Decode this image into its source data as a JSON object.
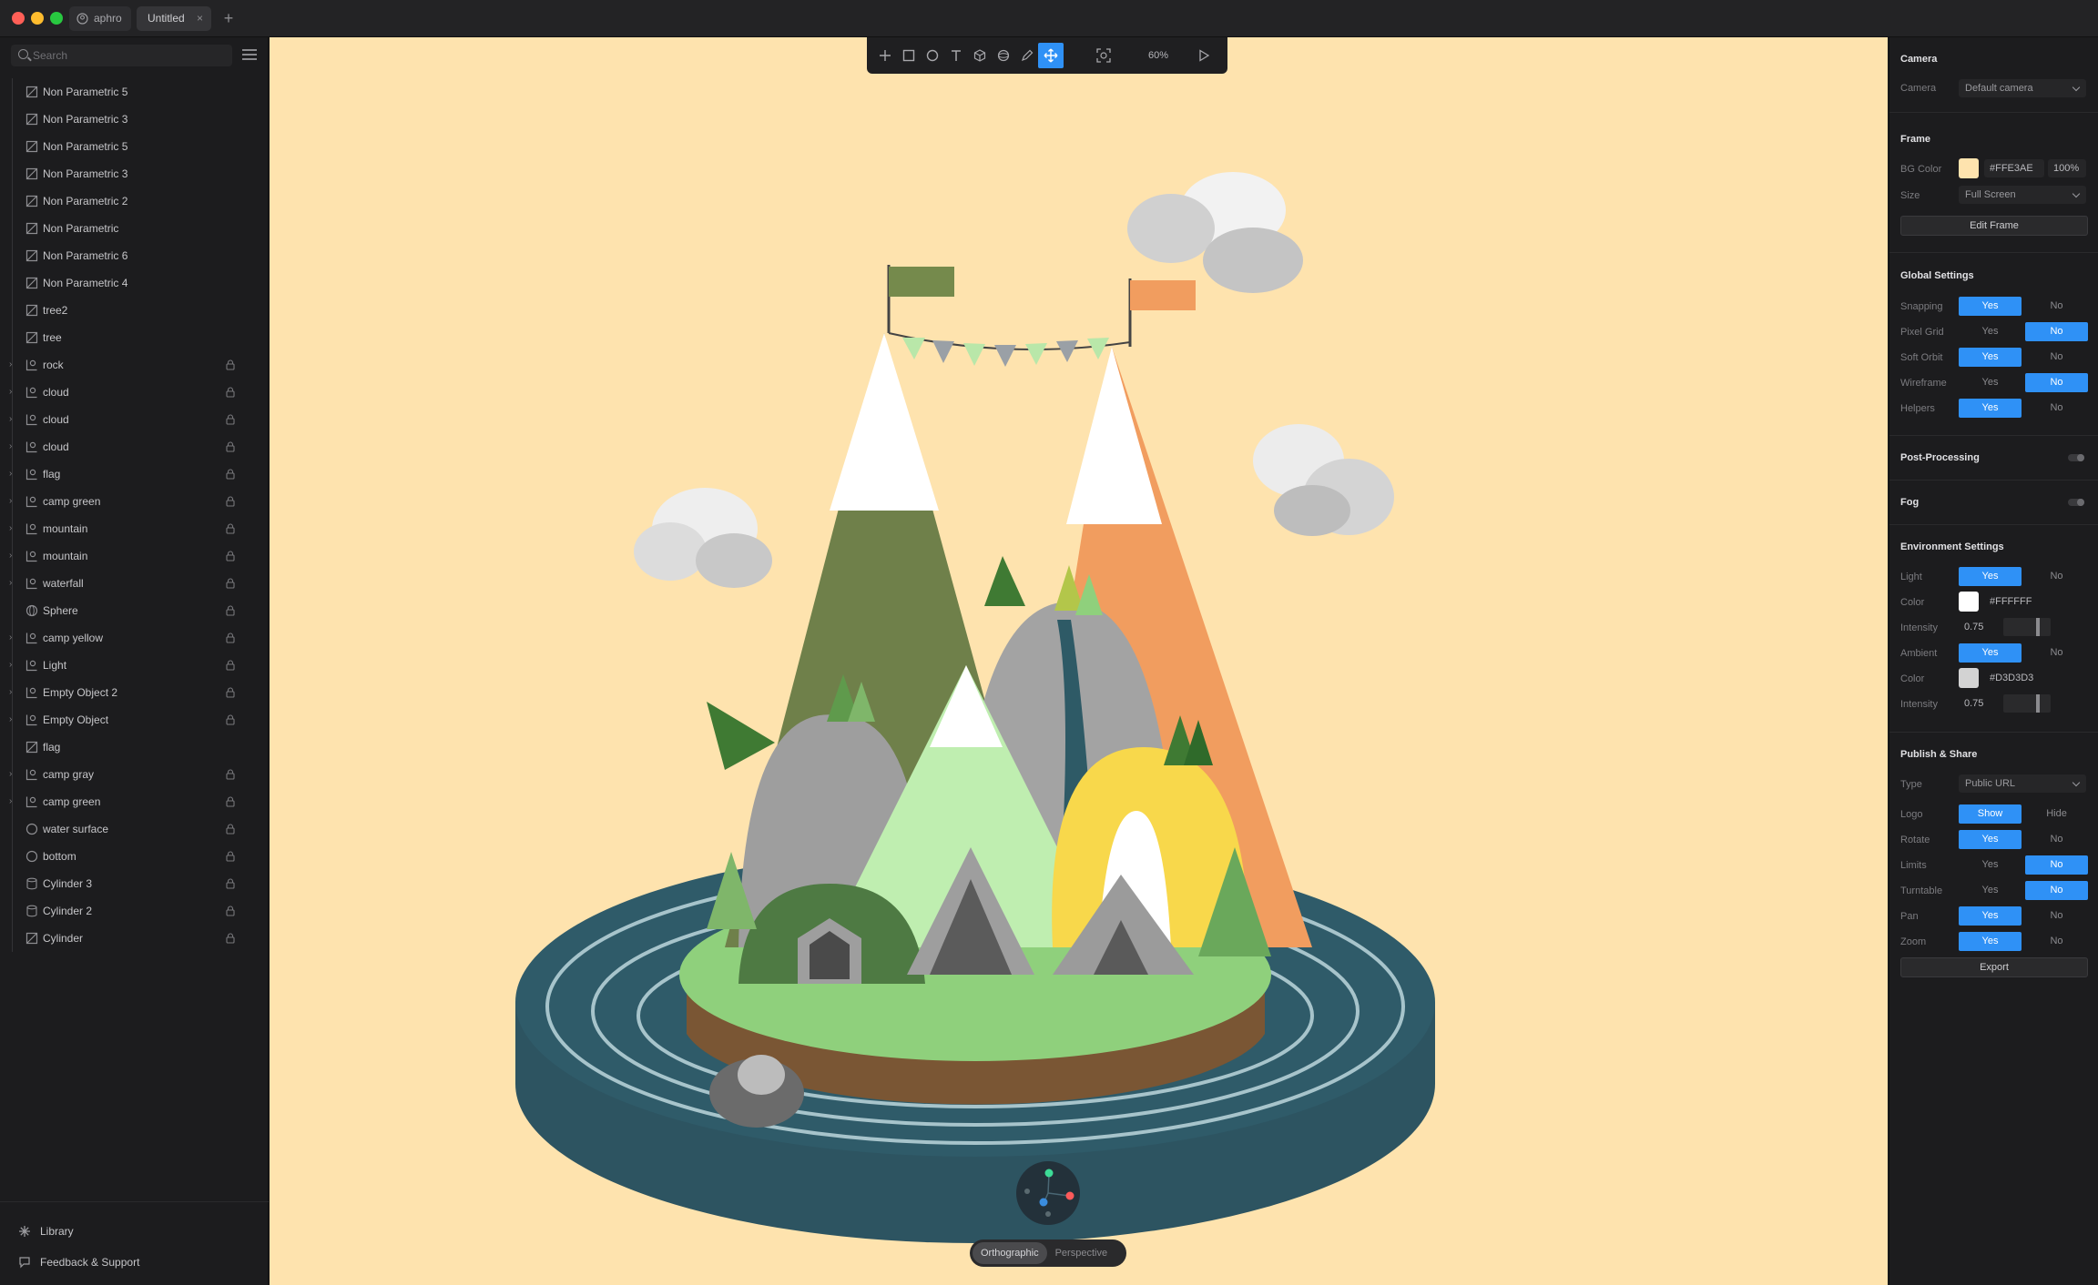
{
  "tabs": {
    "home_label": "aphro",
    "doc_label": "Untitled",
    "close_glyph": "×",
    "add_glyph": "+"
  },
  "sidebar": {
    "search_placeholder": "Search",
    "layers": [
      {
        "name": "Non Parametric 5",
        "icon": "mesh-icon",
        "expandable": false,
        "locked": false
      },
      {
        "name": "Non Parametric 3",
        "icon": "mesh-icon",
        "expandable": false,
        "locked": false
      },
      {
        "name": "Non Parametric 5",
        "icon": "mesh-icon",
        "expandable": false,
        "locked": false
      },
      {
        "name": "Non Parametric 3",
        "icon": "mesh-icon",
        "expandable": false,
        "locked": false
      },
      {
        "name": "Non Parametric 2",
        "icon": "mesh-icon",
        "expandable": false,
        "locked": false
      },
      {
        "name": "Non Parametric",
        "icon": "mesh-icon",
        "expandable": false,
        "locked": false
      },
      {
        "name": "Non Parametric 6",
        "icon": "mesh-icon",
        "expandable": false,
        "locked": false
      },
      {
        "name": "Non Parametric 4",
        "icon": "mesh-icon",
        "expandable": false,
        "locked": false
      },
      {
        "name": "tree2",
        "icon": "mesh-icon",
        "expandable": false,
        "locked": false
      },
      {
        "name": "tree",
        "icon": "mesh-icon",
        "expandable": false,
        "locked": false
      },
      {
        "name": "rock",
        "icon": "group-icon",
        "expandable": true,
        "locked": true
      },
      {
        "name": "cloud",
        "icon": "group-icon",
        "expandable": true,
        "locked": true
      },
      {
        "name": "cloud",
        "icon": "group-icon",
        "expandable": true,
        "locked": true
      },
      {
        "name": "cloud",
        "icon": "group-icon",
        "expandable": true,
        "locked": true
      },
      {
        "name": "flag",
        "icon": "group-icon",
        "expandable": true,
        "locked": true
      },
      {
        "name": "camp green",
        "icon": "group-icon",
        "expandable": true,
        "locked": true
      },
      {
        "name": "mountain",
        "icon": "group-icon",
        "expandable": true,
        "locked": true
      },
      {
        "name": "mountain",
        "icon": "group-icon",
        "expandable": true,
        "locked": true
      },
      {
        "name": "waterfall",
        "icon": "group-icon",
        "expandable": true,
        "locked": true
      },
      {
        "name": "Sphere",
        "icon": "sphere-icon",
        "expandable": false,
        "locked": true
      },
      {
        "name": "camp yellow",
        "icon": "group-icon",
        "expandable": true,
        "locked": true
      },
      {
        "name": "Light",
        "icon": "group-icon",
        "expandable": true,
        "locked": true
      },
      {
        "name": "Empty Object 2",
        "icon": "group-icon",
        "expandable": true,
        "locked": true
      },
      {
        "name": "Empty Object",
        "icon": "group-icon",
        "expandable": true,
        "locked": true
      },
      {
        "name": "flag",
        "icon": "mesh-icon",
        "expandable": false,
        "locked": false
      },
      {
        "name": "camp gray",
        "icon": "group-icon",
        "expandable": true,
        "locked": true
      },
      {
        "name": "camp green",
        "icon": "group-icon",
        "expandable": true,
        "locked": true
      },
      {
        "name": "water surface",
        "icon": "circle-icon",
        "expandable": false,
        "locked": true
      },
      {
        "name": "bottom",
        "icon": "circle-icon",
        "expandable": false,
        "locked": true
      },
      {
        "name": "Cylinder 3",
        "icon": "cylinder-icon",
        "expandable": false,
        "locked": true
      },
      {
        "name": "Cylinder 2",
        "icon": "cylinder-icon",
        "expandable": false,
        "locked": true
      },
      {
        "name": "Cylinder",
        "icon": "mesh-icon",
        "expandable": false,
        "locked": true
      }
    ],
    "library_label": "Library",
    "feedback_label": "Feedback & Support"
  },
  "toolbar": {
    "zoom": "60%",
    "active_tool": "move-icon"
  },
  "viewport": {
    "projection_options": [
      "Orthographic",
      "Perspective"
    ],
    "projection_active": "Orthographic"
  },
  "panel": {
    "camera": {
      "title": "Camera",
      "label": "Camera",
      "value": "Default camera"
    },
    "frame": {
      "title": "Frame",
      "bg_label": "BG Color",
      "bg_color": "#FEE3AE",
      "bg_hex": "#FFE3AE",
      "bg_opacity": "100%",
      "size_label": "Size",
      "size_value": "Full Screen",
      "edit_label": "Edit Frame"
    },
    "global": {
      "title": "Global Settings",
      "rows": [
        {
          "label": "Snapping",
          "yes": "Yes",
          "no": "No",
          "value": "yes"
        },
        {
          "label": "Pixel Grid",
          "yes": "Yes",
          "no": "No",
          "value": "no"
        },
        {
          "label": "Soft Orbit",
          "yes": "Yes",
          "no": "No",
          "value": "yes"
        },
        {
          "label": "Wireframe",
          "yes": "Yes",
          "no": "No",
          "value": "no"
        },
        {
          "label": "Helpers",
          "yes": "Yes",
          "no": "No",
          "value": "yes"
        }
      ]
    },
    "post_processing": {
      "title": "Post-Processing",
      "enabled": false
    },
    "fog": {
      "title": "Fog",
      "enabled": false
    },
    "environment": {
      "title": "Environment Settings",
      "light_label": "Light",
      "light_yes": "Yes",
      "light_no": "No",
      "light_value": "yes",
      "color_label": "Color",
      "light_color": "#FFFFFF",
      "light_hex": "#FFFFFF",
      "intensity_label": "Intensity",
      "light_intensity": "0.75",
      "light_intensity_level": 0.75,
      "ambient_label": "Ambient",
      "ambient_yes": "Yes",
      "ambient_no": "No",
      "ambient_value": "yes",
      "ambient_color_label": "Color",
      "ambient_color": "#D3D3D3",
      "ambient_hex": "#D3D3D3",
      "ambient_intensity_label": "Intensity",
      "ambient_intensity": "0.75",
      "ambient_intensity_level": 0.75
    },
    "publish": {
      "title": "Publish & Share",
      "type_label": "Type",
      "type_value": "Public URL",
      "rows": [
        {
          "label": "Logo",
          "yes": "Show",
          "no": "Hide",
          "value": "yes"
        },
        {
          "label": "Rotate",
          "yes": "Yes",
          "no": "No",
          "value": "yes"
        },
        {
          "label": "Limits",
          "yes": "Yes",
          "no": "No",
          "value": "no"
        },
        {
          "label": "Turntable",
          "yes": "Yes",
          "no": "No",
          "value": "no"
        },
        {
          "label": "Pan",
          "yes": "Yes",
          "no": "No",
          "value": "yes"
        },
        {
          "label": "Zoom",
          "yes": "Yes",
          "no": "No",
          "value": "yes"
        }
      ],
      "export_label": "Export"
    }
  },
  "colors": {
    "accent": "#2F91F6",
    "canvas_bg": "#FEE3AE"
  }
}
